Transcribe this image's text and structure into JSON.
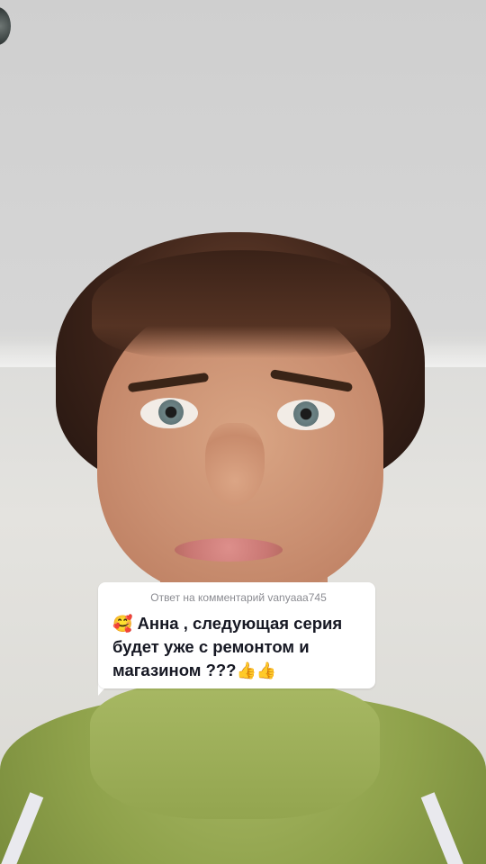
{
  "reply_card": {
    "header": "Ответ на комментарий vanyaaa745",
    "leading_emoji": "🥰",
    "line1": "Анна , следующая серия",
    "line2": "будет уже с ремонтом и",
    "line3": "магазином ???",
    "trailing_emoji": "👍👍"
  },
  "colors": {
    "card_bg": "#ffffff",
    "header_text": "#8a8b91",
    "body_text": "#161823",
    "sweater": "#93a54f"
  },
  "icons": [
    "smiling-face-with-hearts-emoji",
    "thumbs-up-emoji"
  ]
}
